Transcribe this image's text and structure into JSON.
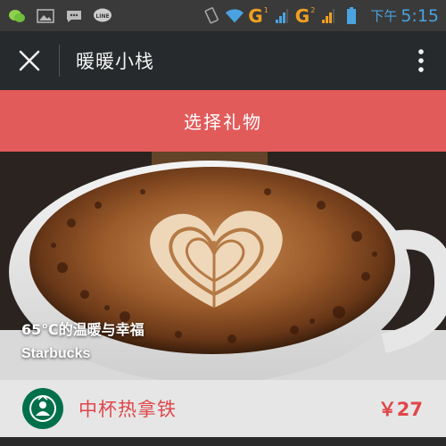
{
  "status_bar": {
    "icons": [
      "wechat-icon",
      "gallery-icon",
      "messages-icon",
      "line-icon",
      "rotation-icon",
      "wifi-icon",
      "signal-icon",
      "battery-icon"
    ],
    "network1": "G",
    "network1_sup": "1",
    "network2": "G",
    "network2_sup": "2",
    "time_prefix": "下午",
    "time": "5:15"
  },
  "app_bar": {
    "title": "暖暖小栈"
  },
  "gift_bar": {
    "label": "选择礼物"
  },
  "hero": {
    "caption_line1": "65℃的温暖与幸福",
    "caption_line2": "Starbucks"
  },
  "product": {
    "name": "中杯热拿铁",
    "price": "￥27",
    "logo_text": "STARBUCKS COFFEE"
  },
  "colors": {
    "accent_red": "#e25b5b",
    "price_red": "#e0464a",
    "app_bar": "#262a2c",
    "status_blue": "#4aa3e0"
  }
}
